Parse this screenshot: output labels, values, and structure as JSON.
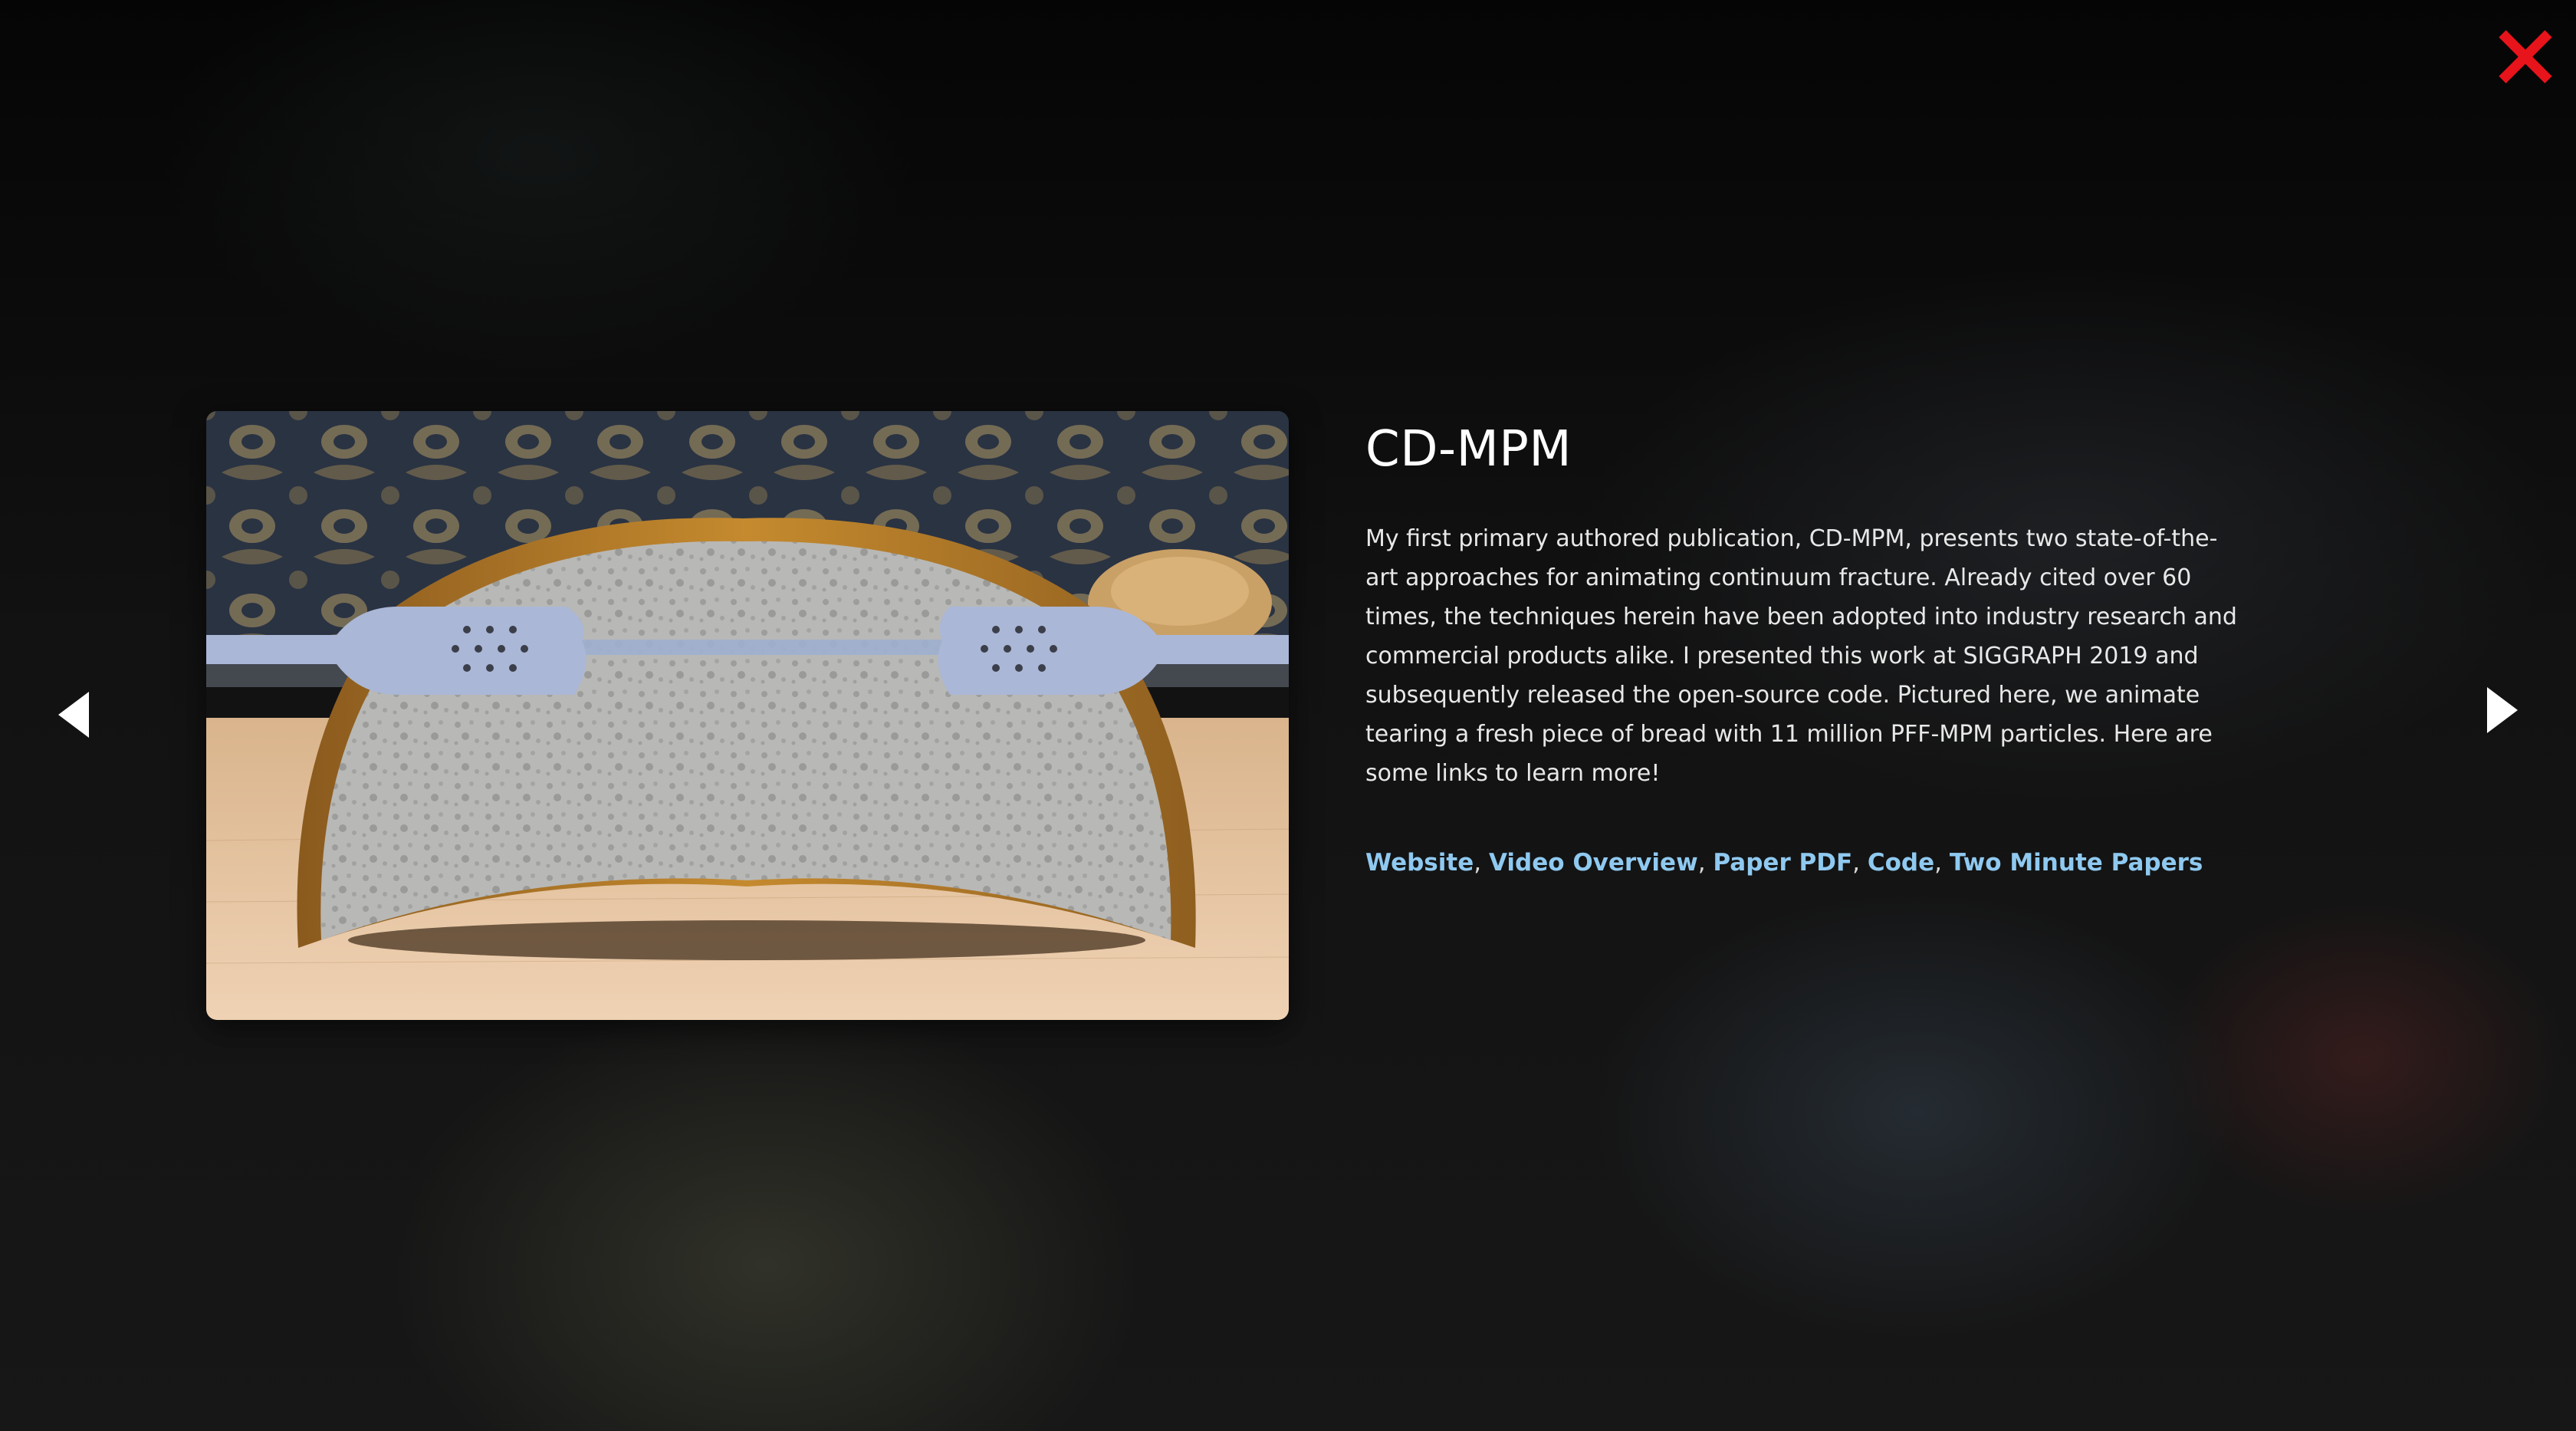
{
  "project": {
    "title": "CD-MPM",
    "description": "My first primary authored publication, CD-MPM, presents two state-of-the-art approaches for animating continuum fracture. Already cited over 60 times, the techniques herein have been adopted into industry research and commercial products alike. I presented this work at SIGGRAPH 2019 and subsequently released the open-source code. Pictured here, we animate tearing a fresh piece of bread with 11 million PFF-MPM particles. Here are some links to learn more!",
    "image_alt": "Simulated bread being torn apart by two grippers",
    "links": [
      {
        "label": "Website"
      },
      {
        "label": "Video Overview"
      },
      {
        "label": "Paper PDF"
      },
      {
        "label": "Code"
      },
      {
        "label": "Two Minute Papers"
      }
    ],
    "link_separator": ", "
  },
  "controls": {
    "close_icon": "close-icon",
    "prev_icon": "arrow-left-icon",
    "next_icon": "arrow-right-icon"
  },
  "colors": {
    "close": "#e8141b",
    "link": "#8fc9f0",
    "text": "#e8e8e8",
    "background": "#0b0b0b"
  }
}
